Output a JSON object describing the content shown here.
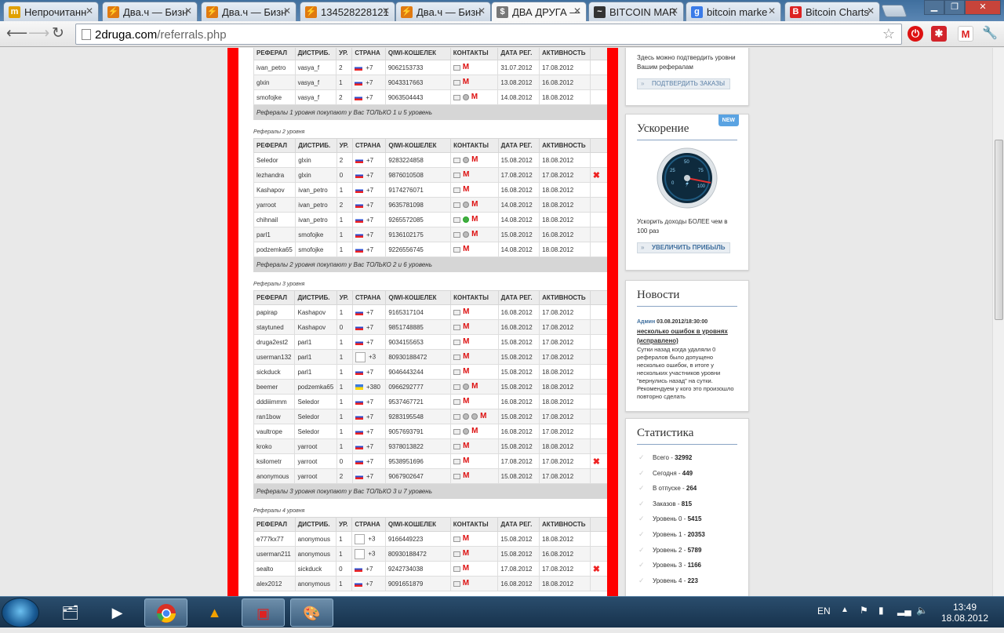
{
  "browser": {
    "tabs": [
      {
        "title": "Непрочитанн",
        "icon": "m",
        "color": "#e0a000"
      },
      {
        "title": "Два.ч — Бизн",
        "icon": "⚡",
        "color": "#e07a10"
      },
      {
        "title": "Два.ч — Бизн",
        "icon": "⚡",
        "color": "#e07a10"
      },
      {
        "title": "134528228121",
        "icon": "⚡",
        "color": "#e07a10"
      },
      {
        "title": "Два.ч — Бизн",
        "icon": "⚡",
        "color": "#e07a10"
      },
      {
        "title": "ДВА ДРУГА —",
        "icon": "$",
        "color": "#777"
      },
      {
        "title": "BITCOIN MAR",
        "icon": "~",
        "color": "#333"
      },
      {
        "title": "bitcoin marke",
        "icon": "g",
        "color": "#3a7be8"
      },
      {
        "title": "Bitcoin Charts",
        "icon": "B",
        "color": "#d22"
      }
    ],
    "active_tab": 5,
    "url_domain": "2druga.com",
    "url_path": "/referrals.php"
  },
  "level1": {
    "headers": [
      "РЕФЕРАЛ",
      "ДИСТРИБ.",
      "УР.",
      "СТРАНА",
      "QIWI-КОШЕЛЕК",
      "КОНТАКТЫ",
      "ДАТА РЕГ.",
      "АКТИВНОСТЬ"
    ],
    "rows": [
      {
        "ref": "ivan_petro",
        "dist": "vasya_f",
        "lvl": "2",
        "code": "+7",
        "flag": "ru",
        "qiwi": "9062153733",
        "contacts": [
          "e",
          "g"
        ],
        "reg": "31.07.2012",
        "act": "17.08.2012",
        "del": false
      },
      {
        "ref": "glxin",
        "dist": "vasya_f",
        "lvl": "1",
        "code": "+7",
        "flag": "ru",
        "qiwi": "9043317663",
        "contacts": [
          "e",
          "g"
        ],
        "reg": "13.08.2012",
        "act": "16.08.2012",
        "del": false
      },
      {
        "ref": "smofojke",
        "dist": "vasya_f",
        "lvl": "2",
        "code": "+7",
        "flag": "ru",
        "qiwi": "9063504443",
        "contacts": [
          "e",
          "s",
          "g"
        ],
        "reg": "14.08.2012",
        "act": "18.08.2012",
        "del": false
      }
    ],
    "footer": "Рефералы 1 уровня покупают у Вас ТОЛЬКО 1 и 5 уровень"
  },
  "level2": {
    "title": "Рефералы 2 уровня",
    "headers": [
      "РЕФЕРАЛ",
      "ДИСТРИБ.",
      "УР.",
      "СТРАНА",
      "QIWI-КОШЕЛЕК",
      "КОНТАКТЫ",
      "ДАТА РЕГ.",
      "АКТИВНОСТЬ"
    ],
    "rows": [
      {
        "ref": "Seledor",
        "dist": "glxin",
        "lvl": "2",
        "code": "+7",
        "flag": "ru",
        "qiwi": "9283224858",
        "contacts": [
          "e",
          "s",
          "g"
        ],
        "reg": "15.08.2012",
        "act": "18.08.2012",
        "del": false
      },
      {
        "ref": "lezhandra",
        "dist": "glxin",
        "lvl": "0",
        "code": "+7",
        "flag": "ru",
        "qiwi": "9876010508",
        "contacts": [
          "e",
          "g"
        ],
        "reg": "17.08.2012",
        "act": "17.08.2012",
        "del": true
      },
      {
        "ref": "Kashapov",
        "dist": "ivan_petro",
        "lvl": "1",
        "code": "+7",
        "flag": "ru",
        "qiwi": "9174276071",
        "contacts": [
          "e",
          "g"
        ],
        "reg": "16.08.2012",
        "act": "18.08.2012",
        "del": false
      },
      {
        "ref": "yarroot",
        "dist": "ivan_petro",
        "lvl": "2",
        "code": "+7",
        "flag": "ru",
        "qiwi": "9635781098",
        "contacts": [
          "e",
          "s",
          "g"
        ],
        "reg": "14.08.2012",
        "act": "18.08.2012",
        "del": false
      },
      {
        "ref": "chihnail",
        "dist": "ivan_petro",
        "lvl": "1",
        "code": "+7",
        "flag": "ru",
        "qiwi": "9265572085",
        "contacts": [
          "e",
          "ic",
          "g"
        ],
        "reg": "14.08.2012",
        "act": "18.08.2012",
        "del": false
      },
      {
        "ref": "parl1",
        "dist": "smofojke",
        "lvl": "1",
        "code": "+7",
        "flag": "ru",
        "qiwi": "9136102175",
        "contacts": [
          "e",
          "s",
          "g"
        ],
        "reg": "15.08.2012",
        "act": "16.08.2012",
        "del": false
      },
      {
        "ref": "podzemka65",
        "dist": "smofojke",
        "lvl": "1",
        "code": "+7",
        "flag": "ru",
        "qiwi": "9226556745",
        "contacts": [
          "e",
          "g"
        ],
        "reg": "14.08.2012",
        "act": "18.08.2012",
        "del": false
      }
    ],
    "footer": "Рефералы 2 уровня покупают у Вас ТОЛЬКО 2 и 6 уровень"
  },
  "level3": {
    "title": "Рефералы 3 уровня",
    "headers": [
      "РЕФЕРАЛ",
      "ДИСТРИБ.",
      "УР.",
      "СТРАНА",
      "QIWI-КОШЕЛЕК",
      "КОНТАКТЫ",
      "ДАТА РЕГ.",
      "АКТИВНОСТЬ"
    ],
    "rows": [
      {
        "ref": "papirap",
        "dist": "Kashapov",
        "lvl": "1",
        "code": "+7",
        "flag": "ru",
        "qiwi": "9165317104",
        "contacts": [
          "e",
          "g"
        ],
        "reg": "16.08.2012",
        "act": "17.08.2012",
        "del": false
      },
      {
        "ref": "staytuned",
        "dist": "Kashapov",
        "lvl": "0",
        "code": "+7",
        "flag": "ru",
        "qiwi": "9851748885",
        "contacts": [
          "e",
          "g"
        ],
        "reg": "16.08.2012",
        "act": "17.08.2012",
        "del": false
      },
      {
        "ref": "druga2est2",
        "dist": "parl1",
        "lvl": "1",
        "code": "+7",
        "flag": "ru",
        "qiwi": "9034155653",
        "contacts": [
          "e",
          "g"
        ],
        "reg": "15.08.2012",
        "act": "17.08.2012",
        "del": false
      },
      {
        "ref": "userman132",
        "dist": "parl1",
        "lvl": "1",
        "code": "+3",
        "flag": "blank",
        "qiwi": "80930188472",
        "contacts": [
          "e",
          "g"
        ],
        "reg": "15.08.2012",
        "act": "17.08.2012",
        "del": false
      },
      {
        "ref": "sickduck",
        "dist": "parl1",
        "lvl": "1",
        "code": "+7",
        "flag": "ru",
        "qiwi": "9046443244",
        "contacts": [
          "e",
          "g"
        ],
        "reg": "15.08.2012",
        "act": "18.08.2012",
        "del": false
      },
      {
        "ref": "beemer",
        "dist": "podzemka65",
        "lvl": "1",
        "code": "+380",
        "flag": "ua",
        "qiwi": "0966292777",
        "contacts": [
          "e",
          "s",
          "g"
        ],
        "reg": "15.08.2012",
        "act": "18.08.2012",
        "del": false
      },
      {
        "ref": "dddiiimmm",
        "dist": "Seledor",
        "lvl": "1",
        "code": "+7",
        "flag": "ru",
        "qiwi": "9537467721",
        "contacts": [
          "e",
          "g"
        ],
        "reg": "16.08.2012",
        "act": "18.08.2012",
        "del": false
      },
      {
        "ref": "ran1bow",
        "dist": "Seledor",
        "lvl": "1",
        "code": "+7",
        "flag": "ru",
        "qiwi": "9283195548",
        "contacts": [
          "e",
          "s",
          "s",
          "g"
        ],
        "reg": "15.08.2012",
        "act": "17.08.2012",
        "del": false
      },
      {
        "ref": "vaultrope",
        "dist": "Seledor",
        "lvl": "1",
        "code": "+7",
        "flag": "ru",
        "qiwi": "9057693791",
        "contacts": [
          "e",
          "s",
          "g"
        ],
        "reg": "16.08.2012",
        "act": "17.08.2012",
        "del": false
      },
      {
        "ref": "kroko",
        "dist": "yarroot",
        "lvl": "1",
        "code": "+7",
        "flag": "ru",
        "qiwi": "9378013822",
        "contacts": [
          "e",
          "g"
        ],
        "reg": "15.08.2012",
        "act": "18.08.2012",
        "del": false
      },
      {
        "ref": "ksilometr",
        "dist": "yarroot",
        "lvl": "0",
        "code": "+7",
        "flag": "ru",
        "qiwi": "9538951696",
        "contacts": [
          "e",
          "g"
        ],
        "reg": "17.08.2012",
        "act": "17.08.2012",
        "del": true
      },
      {
        "ref": "anonymous",
        "dist": "yarroot",
        "lvl": "2",
        "code": "+7",
        "flag": "ru",
        "qiwi": "9067902647",
        "contacts": [
          "e",
          "g"
        ],
        "reg": "15.08.2012",
        "act": "17.08.2012",
        "del": false
      }
    ],
    "footer": "Рефералы 3 уровня покупают у Вас ТОЛЬКО 3 и 7 уровень"
  },
  "level4": {
    "title": "Рефералы 4 уровня",
    "headers": [
      "РЕФЕРАЛ",
      "ДИСТРИБ.",
      "УР.",
      "СТРАНА",
      "QIWI-КОШЕЛЕК",
      "КОНТАКТЫ",
      "ДАТА РЕГ.",
      "АКТИВНОСТЬ"
    ],
    "rows": [
      {
        "ref": "e777kx77",
        "dist": "anonymous",
        "lvl": "1",
        "code": "+3",
        "flag": "blank",
        "qiwi": "9166449223",
        "contacts": [
          "e",
          "g"
        ],
        "reg": "15.08.2012",
        "act": "18.08.2012",
        "del": false
      },
      {
        "ref": "userman211",
        "dist": "anonymous",
        "lvl": "1",
        "code": "+3",
        "flag": "blank",
        "qiwi": "80930188472",
        "contacts": [
          "e",
          "g"
        ],
        "reg": "15.08.2012",
        "act": "16.08.2012",
        "del": false
      },
      {
        "ref": "sealto",
        "dist": "sickduck",
        "lvl": "0",
        "code": "+7",
        "flag": "ru",
        "qiwi": "9242734038",
        "contacts": [
          "e",
          "g"
        ],
        "reg": "17.08.2012",
        "act": "17.08.2012",
        "del": true
      },
      {
        "ref": "alex2012",
        "dist": "anonymous",
        "lvl": "1",
        "code": "+7",
        "flag": "ru",
        "qiwi": "9091651879",
        "contacts": [
          "e",
          "g"
        ],
        "reg": "16.08.2012",
        "act": "18.08.2012",
        "del": false
      }
    ]
  },
  "sidebar": {
    "confirm_text": "Здесь можно подтвердить уровни Вашим рефералам",
    "confirm_btn": "ПОДТВЕРДИТЬ ЗАКАЗЫ",
    "boost_title": "Ускорение",
    "boost_badge": "NEW",
    "boost_text": "Ускорить доходы БОЛЕЕ чем в 100 раз",
    "boost_btn": "УВЕЛИЧИТЬ ПРИБЫЛЬ",
    "news_title": "Новости",
    "news_author": "Админ",
    "news_date": "03.08.2012/18:30:00",
    "news_headline": "несколько ошибок в уровнях (исправлено)",
    "news_body": "Сутки назад когда удаляли 0 рефералов было допущено несколько ошибок, в итоге у нескольких участников уровни \"вернулись назад\" на сутки. Рекомендуем у кого это произошло повторно сделать",
    "stats_title": "Статистика",
    "stats": [
      {
        "label": "Всего",
        "value": "32992"
      },
      {
        "label": "Сегодня",
        "value": "449"
      },
      {
        "label": "В отпуске",
        "value": "264"
      },
      {
        "label": "Заказов",
        "value": "815"
      },
      {
        "label": "Уровень 0",
        "value": "5415"
      },
      {
        "label": "Уровень 1",
        "value": "20353"
      },
      {
        "label": "Уровень 2",
        "value": "5789"
      },
      {
        "label": "Уровень 3",
        "value": "1166"
      },
      {
        "label": "Уровень 4",
        "value": "223"
      }
    ]
  },
  "taskbar": {
    "lang": "EN",
    "time": "13:49",
    "date": "18.08.2012"
  }
}
